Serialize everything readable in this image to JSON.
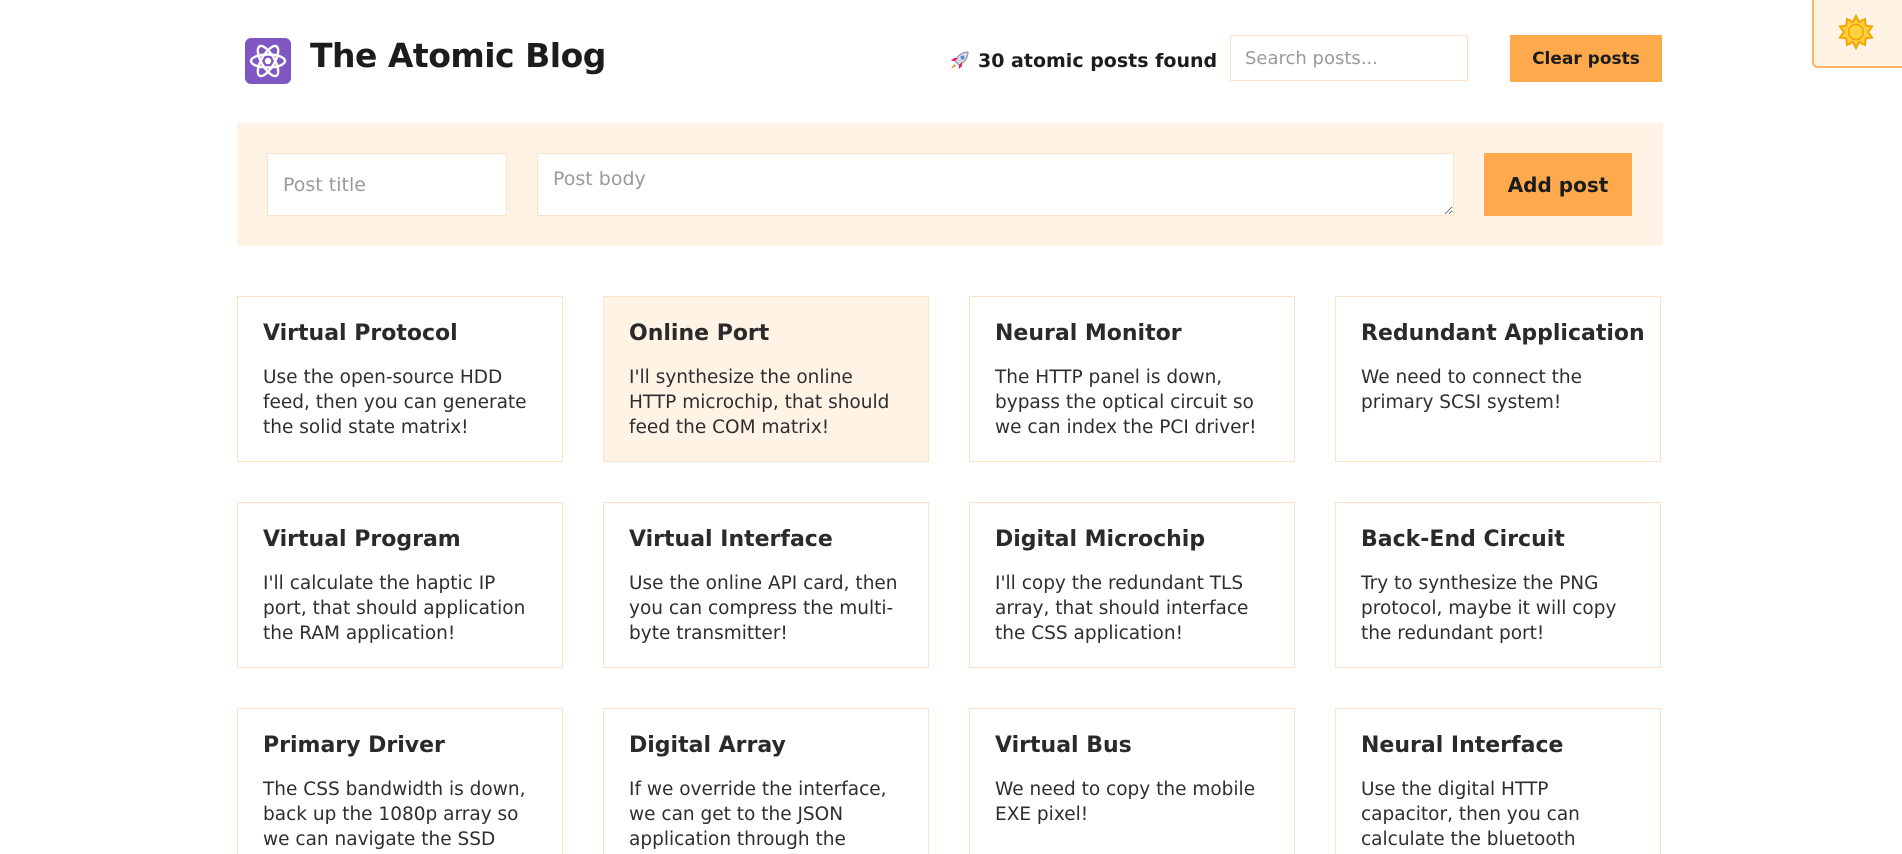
{
  "header": {
    "title": "The Atomic Blog",
    "logo_icon": "atom-icon",
    "posts_found_icon": "rocket-icon",
    "posts_found_text": "30 atomic posts found",
    "search_placeholder": "Search posts...",
    "clear_label": "Clear posts"
  },
  "theme_toggle": {
    "icon": "sun-icon"
  },
  "form": {
    "title_placeholder": "Post title",
    "body_placeholder": "Post body",
    "submit_label": "Add post"
  },
  "posts": [
    {
      "title": "Virtual Protocol",
      "body": "Use the open-source HDD feed, then you can generate the solid state matrix!"
    },
    {
      "title": "Online Port",
      "body": "I'll synthesize the online HTTP microchip, that should feed the COM matrix!"
    },
    {
      "title": "Neural Monitor",
      "body": "The HTTP panel is down, bypass the optical circuit so we can index the PCI driver!"
    },
    {
      "title": "Redundant Application",
      "body": "We need to connect the primary SCSI system!"
    },
    {
      "title": "Virtual Program",
      "body": "I'll calculate the haptic IP port, that should application the RAM application!"
    },
    {
      "title": "Virtual Interface",
      "body": "Use the online API card, then you can compress the multi-byte transmitter!"
    },
    {
      "title": "Digital Microchip",
      "body": "I'll copy the redundant TLS array, that should interface the CSS application!"
    },
    {
      "title": "Back-End Circuit",
      "body": "Try to synthesize the PNG protocol, maybe it will copy the redundant port!"
    },
    {
      "title": "Primary Driver",
      "body": "The CSS bandwidth is down, back up the 1080p array so we can navigate the SSD program!"
    },
    {
      "title": "Digital Array",
      "body": "If we override the interface, we can get to the JSON application through the"
    },
    {
      "title": "Virtual Bus",
      "body": "We need to copy the mobile EXE pixel!"
    },
    {
      "title": "Neural Interface",
      "body": "Use the digital HTTP capacitor, then you can calculate the bluetooth panel!"
    }
  ],
  "colors": {
    "accent": "#ffa94d",
    "panel_bg": "#fef3e5",
    "border": "#fde3c6",
    "logo_bg": "#7e57c2"
  }
}
